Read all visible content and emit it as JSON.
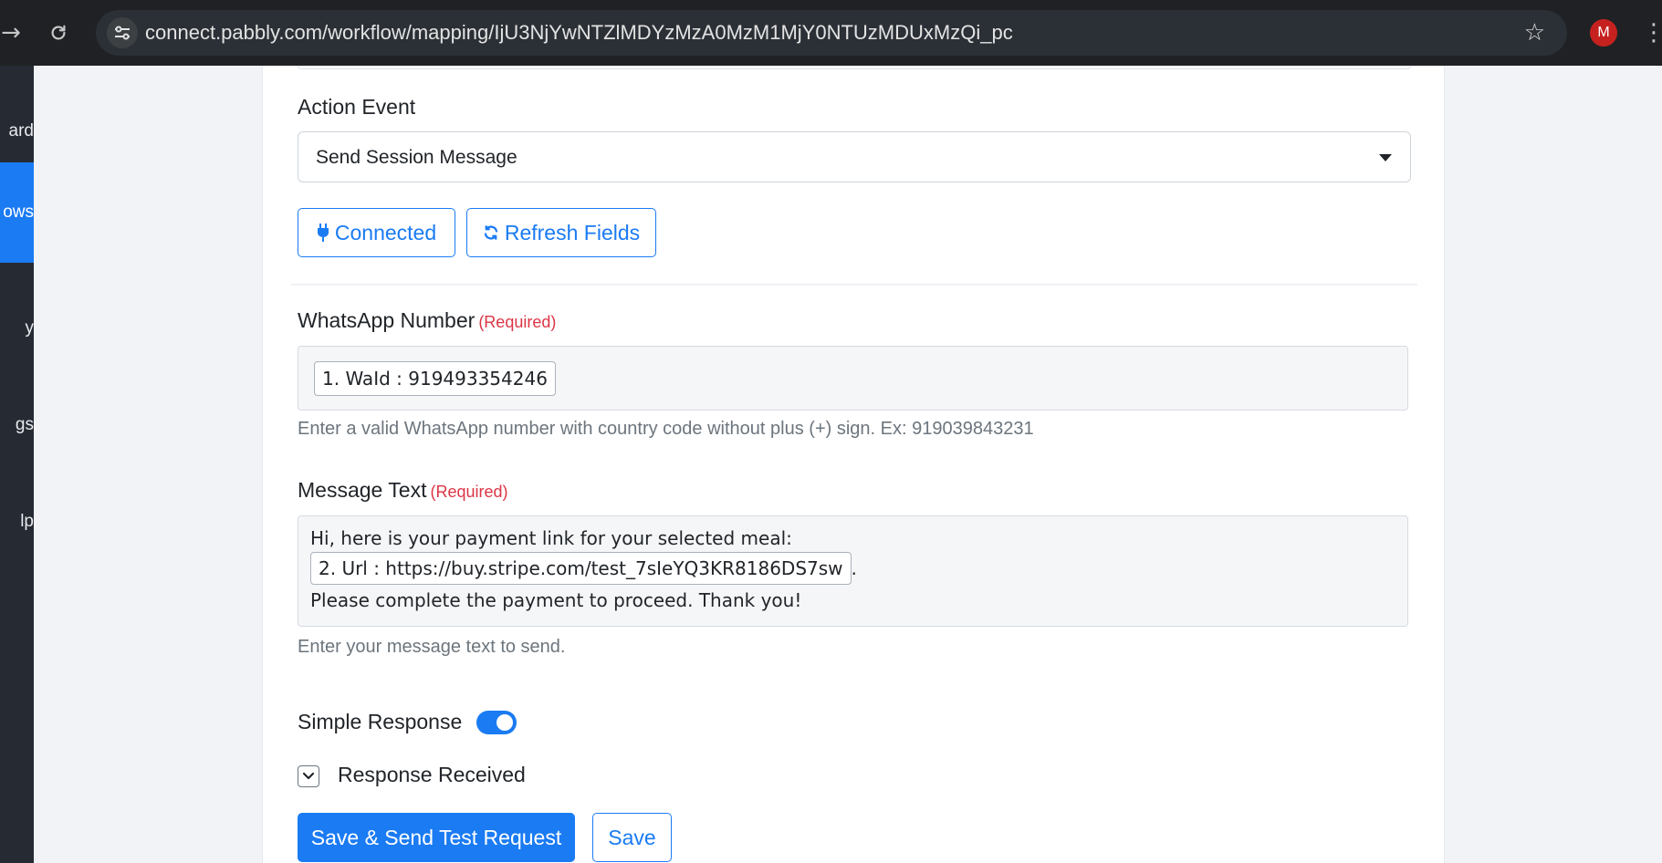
{
  "browser": {
    "url": "connect.pabbly.com/workflow/mapping/IjU3NjYwNTZlMDYzMzA0MzM1MjY0NTUzMDUxMzQi_pc",
    "profile_initial": "M"
  },
  "sidebar": {
    "items": [
      {
        "label": "ard"
      },
      {
        "label": "ows"
      },
      {
        "label": "y"
      },
      {
        "label": "gs"
      },
      {
        "label": "lp"
      }
    ]
  },
  "form": {
    "action_event": {
      "label": "Action Event",
      "value": "Send Session Message"
    },
    "connected_button": "Connected",
    "refresh_button": "Refresh Fields",
    "whatsapp_number": {
      "label": "WhatsApp Number",
      "required": "(Required)",
      "token": "1. WaId : 919493354246",
      "help": "Enter a valid WhatsApp number with country code without plus (+) sign. Ex: 919039843231"
    },
    "message_text": {
      "label": "Message Text",
      "required": "(Required)",
      "line1": "Hi, here is your payment link for your selected meal:",
      "token": "2. Url : https://buy.stripe.com/test_7sIeYQ3KR8186DS7sw",
      "after_token": ".",
      "line3": "Please complete the payment to proceed. Thank you!",
      "help": "Enter your message text to send."
    },
    "simple_response": {
      "label": "Simple Response",
      "enabled": true
    },
    "response_received": {
      "label": "Response Received"
    },
    "save_send_button": "Save & Send Test Request",
    "save_button": "Save"
  }
}
